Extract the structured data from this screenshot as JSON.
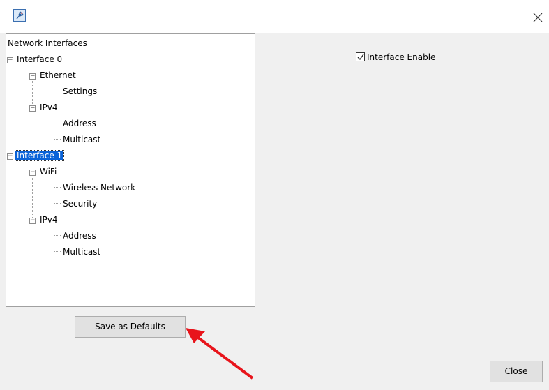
{
  "window": {
    "app_icon": "pushpin-icon",
    "close_icon": "close-icon"
  },
  "tree": {
    "root_label": "Network Interfaces",
    "interfaces": [
      {
        "label": "Interface 0",
        "selected": false,
        "groups": [
          {
            "label": "Ethernet",
            "children": [
              "Settings"
            ]
          },
          {
            "label": "IPv4",
            "children": [
              "Address",
              "Multicast"
            ]
          }
        ]
      },
      {
        "label": "Interface 1",
        "selected": true,
        "groups": [
          {
            "label": "WiFi",
            "children": [
              "Wireless Network",
              "Security"
            ]
          },
          {
            "label": "IPv4",
            "children": [
              "Address",
              "Multicast"
            ]
          }
        ]
      }
    ]
  },
  "settings": {
    "interface_enable_label": "Interface Enable",
    "interface_enable_checked": true
  },
  "buttons": {
    "save_defaults_label": "Save as Defaults",
    "close_label": "Close"
  },
  "annotation": {
    "arrow_color": "#e8141b"
  }
}
